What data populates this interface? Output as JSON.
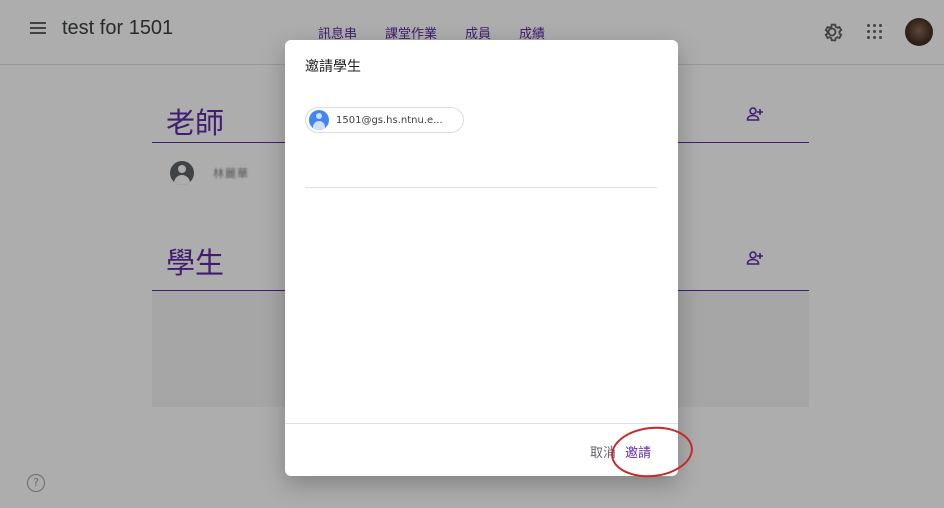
{
  "header": {
    "title": "test for 1501",
    "tabs": [
      {
        "label": "訊息串"
      },
      {
        "label": "課堂作業"
      },
      {
        "label": "成員"
      },
      {
        "label": "成績"
      }
    ]
  },
  "people": {
    "teachers_title": "老師",
    "teacher_name": "林麗華",
    "students_title": "學生"
  },
  "dialog": {
    "title": "邀請學生",
    "chip_email": "1501@gs.hs.ntnu.e...",
    "cancel_label": "取消",
    "invite_label": "邀請"
  },
  "help_symbol": "?",
  "colors": {
    "accent": "#5f2ca6",
    "annotation": "#c62828"
  }
}
